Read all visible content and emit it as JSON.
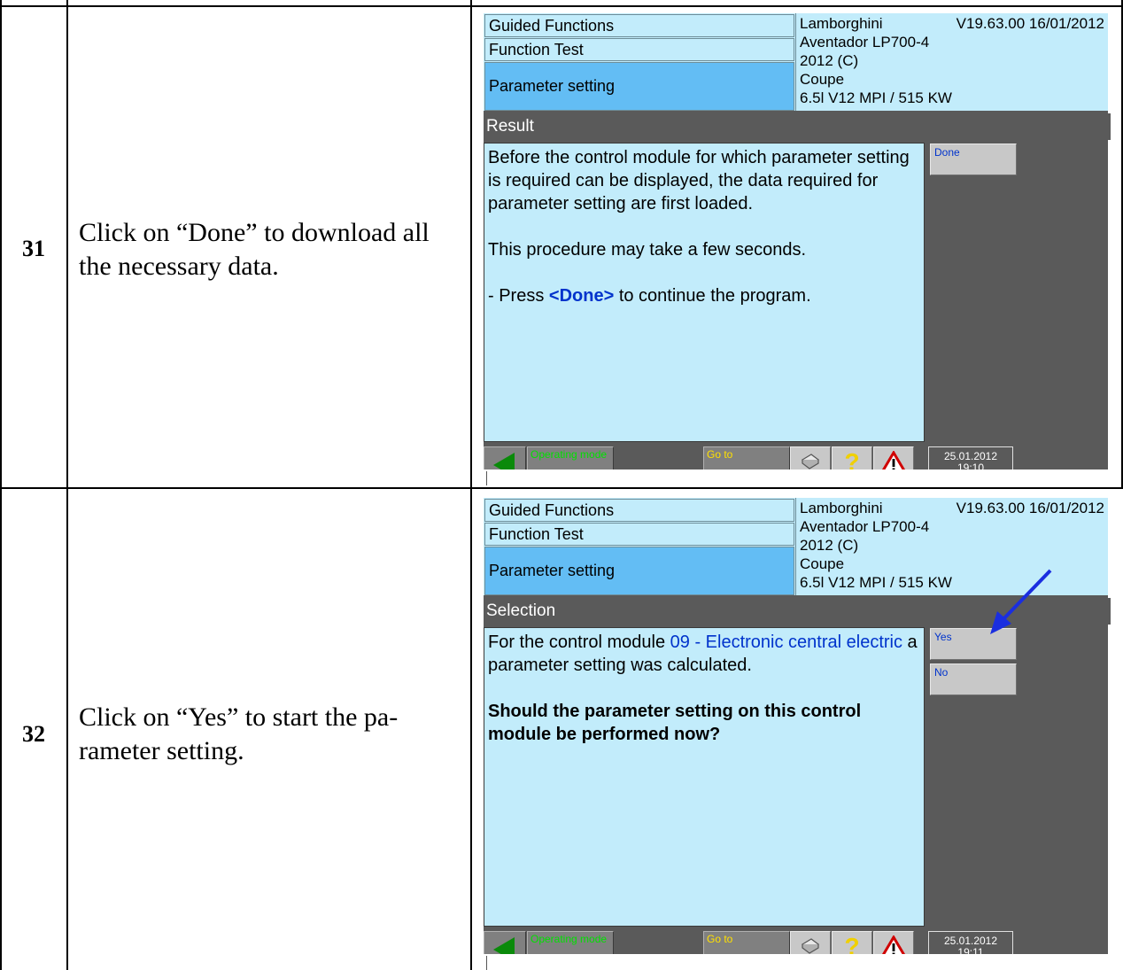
{
  "steps": [
    {
      "number": "31",
      "instruction": "Click on “Done” to download all the necessary data.",
      "screen": {
        "header": {
          "breadcrumb": [
            "Guided Functions",
            "Function Test",
            "Parameter setting"
          ],
          "make_model": "Lamborghini",
          "version": "V19.63.00 16/01/2012",
          "vehicle": [
            "Aventador LP700-4",
            "2012 (C)",
            "Coupe",
            "6.5l V12 MPI / 515 KW"
          ]
        },
        "section_title": "Result",
        "content": {
          "p1": "Before the control module for which parameter setting is required can be displayed, the data required for parameter setting are first loaded.",
          "p2": "This procedure may take a few seconds.",
          "p3_prefix": "- Press ",
          "p3_key": "<Done>",
          "p3_suffix": " to continue the program."
        },
        "side_buttons": [
          "Done"
        ],
        "bottom_bar": {
          "operating_mode": "Operating mode",
          "goto": "Go to",
          "date": "25.01.2012",
          "time": "19:10"
        }
      }
    },
    {
      "number": "32",
      "instruction": "Click on “Yes” to start the pa-rameter setting.",
      "screen": {
        "header": {
          "breadcrumb": [
            "Guided Functions",
            "Function Test",
            "Parameter setting"
          ],
          "make_model": "Lamborghini",
          "version": "V19.63.00 16/01/2012",
          "vehicle": [
            "Aventador LP700-4",
            "2012 (C)",
            "Coupe",
            "6.5l V12 MPI / 515 KW"
          ]
        },
        "section_title": "Selection",
        "content": {
          "p1_prefix": "For the control module ",
          "p1_module": "09 - Electronic central electric",
          "p1_suffix": "  a parameter setting was calculated.",
          "p2": "Should the parameter setting on this control module be performed now?"
        },
        "side_buttons": [
          "Yes",
          "No"
        ],
        "bottom_bar": {
          "operating_mode": "Operating mode",
          "goto": "Go to",
          "date": "25.01.2012",
          "time": "19:11"
        }
      }
    }
  ],
  "colors": {
    "panel": "#c2ecfb",
    "selected": "#63bdf4",
    "frame": "#5a5a5a",
    "link_blue": "#0033cc",
    "arrow": "#1a2ee0"
  }
}
